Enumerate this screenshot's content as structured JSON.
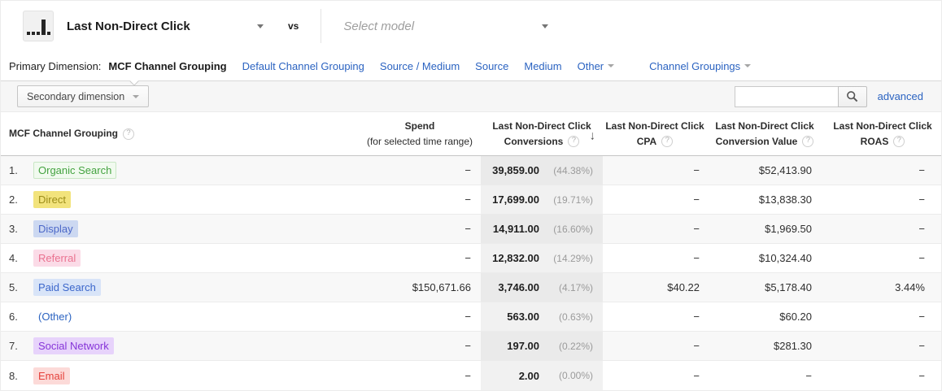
{
  "header": {
    "model_name": "Last Non-Direct Click",
    "vs_label": "vs",
    "select_model_placeholder": "Select model"
  },
  "primary_dimension_bar": {
    "label": "Primary Dimension:",
    "tabs": [
      {
        "label": "MCF Channel Grouping",
        "selected": true,
        "dropdown": false,
        "spaced": false
      },
      {
        "label": "Default Channel Grouping",
        "selected": false,
        "dropdown": false,
        "spaced": false
      },
      {
        "label": "Source / Medium",
        "selected": false,
        "dropdown": false,
        "spaced": false
      },
      {
        "label": "Source",
        "selected": false,
        "dropdown": false,
        "spaced": false
      },
      {
        "label": "Medium",
        "selected": false,
        "dropdown": false,
        "spaced": false
      },
      {
        "label": "Other",
        "selected": false,
        "dropdown": true,
        "spaced": false
      },
      {
        "label": "Channel Groupings",
        "selected": false,
        "dropdown": true,
        "spaced": true
      }
    ]
  },
  "toolbar": {
    "secondary_dimension_label": "Secondary dimension",
    "search_value": "",
    "advanced_label": "advanced"
  },
  "icons": {
    "help_glyph": "?",
    "sort_desc_glyph": "↓"
  },
  "table": {
    "columns": {
      "channel": {
        "title": "MCF Channel Grouping"
      },
      "spend": {
        "line1": "Spend",
        "line2": "(for selected time range)"
      },
      "conversions": {
        "line1": "Last Non-Direct Click",
        "line2": "Conversions",
        "sort": "desc"
      },
      "cpa": {
        "line1": "Last Non-Direct Click",
        "line2": "CPA"
      },
      "conversion_value": {
        "line1": "Last Non-Direct Click",
        "line2": "Conversion Value"
      },
      "roas": {
        "line1": "Last Non-Direct Click",
        "line2": "ROAS"
      }
    },
    "rows": [
      {
        "index": "1.",
        "channel": "Organic Search",
        "chip": "organic-search",
        "spend": "−",
        "conversions": "39,859.00",
        "conversions_pct": "(44.38%)",
        "cpa": "−",
        "conversion_value": "$52,413.90",
        "roas": "−"
      },
      {
        "index": "2.",
        "channel": "Direct",
        "chip": "direct",
        "spend": "−",
        "conversions": "17,699.00",
        "conversions_pct": "(19.71%)",
        "cpa": "−",
        "conversion_value": "$13,838.30",
        "roas": "−"
      },
      {
        "index": "3.",
        "channel": "Display",
        "chip": "display",
        "spend": "−",
        "conversions": "14,911.00",
        "conversions_pct": "(16.60%)",
        "cpa": "−",
        "conversion_value": "$1,969.50",
        "roas": "−"
      },
      {
        "index": "4.",
        "channel": "Referral",
        "chip": "referral",
        "spend": "−",
        "conversions": "12,832.00",
        "conversions_pct": "(14.29%)",
        "cpa": "−",
        "conversion_value": "$10,324.40",
        "roas": "−"
      },
      {
        "index": "5.",
        "channel": "Paid Search",
        "chip": "paid-search",
        "spend": "$150,671.66",
        "conversions": "3,746.00",
        "conversions_pct": "(4.17%)",
        "cpa": "$40.22",
        "conversion_value": "$5,178.40",
        "roas": "3.44%"
      },
      {
        "index": "6.",
        "channel": "(Other)",
        "chip": "other",
        "spend": "−",
        "conversions": "563.00",
        "conversions_pct": "(0.63%)",
        "cpa": "−",
        "conversion_value": "$60.20",
        "roas": "−"
      },
      {
        "index": "7.",
        "channel": "Social Network",
        "chip": "social-network",
        "spend": "−",
        "conversions": "197.00",
        "conversions_pct": "(0.22%)",
        "cpa": "−",
        "conversion_value": "$281.30",
        "roas": "−"
      },
      {
        "index": "8.",
        "channel": "Email",
        "chip": "email",
        "spend": "−",
        "conversions": "2.00",
        "conversions_pct": "(0.00%)",
        "cpa": "−",
        "conversion_value": "−",
        "roas": "−"
      }
    ]
  },
  "channel_chip_styles": {
    "organic-search": {
      "color": "#44a340",
      "background": "#f1faef",
      "border": "#c9e7c5"
    },
    "direct": {
      "color": "#9c8d19",
      "background": "#f2e37c",
      "border": "#f2e37c"
    },
    "display": {
      "color": "#4c68c8",
      "background": "#ccd8f1",
      "border": "#ccd8f1"
    },
    "referral": {
      "color": "#ea7290",
      "background": "#fbdbe7",
      "border": "#fbdbe7"
    },
    "paid-search": {
      "color": "#3c67cb",
      "background": "#d8e4f8",
      "border": "#d8e4f8"
    },
    "other": {
      "color": "#2b63c1",
      "background": "transparent",
      "border": "transparent"
    },
    "social-network": {
      "color": "#8635d8",
      "background": "#e7d3fb",
      "border": "#e7d3fb"
    },
    "email": {
      "color": "#e5413b",
      "background": "#fcdad8",
      "border": "#fcdad8"
    }
  },
  "colors": {
    "link_blue": "#2b63c1",
    "sorted_column_overlay": "rgba(0,0,0,0.053)",
    "row_stripe": "#f8f8f8",
    "toolbar_background": "#f6f6f6"
  }
}
